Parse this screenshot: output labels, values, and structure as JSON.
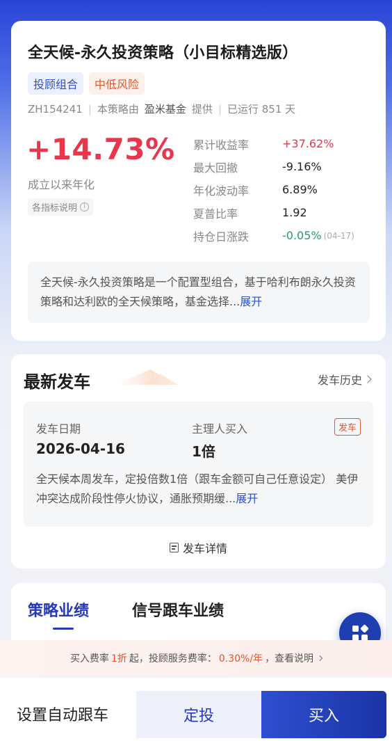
{
  "strategy": {
    "title": "全天候-永久投资策略（小目标精选版）",
    "tags": [
      "投顾组合",
      "中低风险"
    ],
    "code": "ZH154241",
    "provided_by_prefix": "本策略由",
    "provider": "盈米基金",
    "provided_by_suffix": "提供",
    "running": "已运行 851 天",
    "annualized_return": "+14.73%",
    "annualized_label": "成立以来年化",
    "metrics_help": "各指标说明",
    "metrics": [
      {
        "label": "累计收益率",
        "value": "+37.62%",
        "tone": "red"
      },
      {
        "label": "最大回撤",
        "value": "-9.16%",
        "tone": "normal"
      },
      {
        "label": "年化波动率",
        "value": "6.89%",
        "tone": "normal"
      },
      {
        "label": "夏普比率",
        "value": "1.92",
        "tone": "normal"
      },
      {
        "label": "持仓日涨跌",
        "value": "-0.05%",
        "tone": "green",
        "date": "(04-17)"
      }
    ],
    "description": "全天候-永久投资策略是一个配置型组合，基于哈利布朗永久投资策略和达利欧的全天候策略，基金选择...",
    "expand_label": "展开"
  },
  "latest_launch": {
    "section_title": "最新发车",
    "history_label": "发车历史",
    "date_label": "发车日期",
    "date_value": "2026-04-16",
    "manager_label": "主理人买入",
    "manager_value": "1倍",
    "tag": "发车",
    "description": "全天候本周发车，定投倍数1倍（跟车金额可自己任意设定） 美伊冲突达成阶段性停火协议，通胀预期缓...",
    "expand_label": "展开",
    "detail_label": "发车详情"
  },
  "tabs": [
    "策略业绩",
    "信号跟车业绩"
  ],
  "fee_bar": {
    "prefix": "买入费率",
    "buy_rate": "1折",
    "mid": "起，投顾服务费率：",
    "service_rate": "0.30%/年",
    "suffix": "，查看说明"
  },
  "bottom": {
    "auto_follow": "设置自动跟车",
    "dingtou": "定投",
    "buy": "买入"
  },
  "colors": {
    "accent_blue": "#2438b8",
    "red": "#e8374c",
    "green": "#21a06a",
    "orange": "#e4552b"
  },
  "icons": [
    "info-icon",
    "chevron-right-icon",
    "document-icon",
    "grid-menu-icon"
  ]
}
